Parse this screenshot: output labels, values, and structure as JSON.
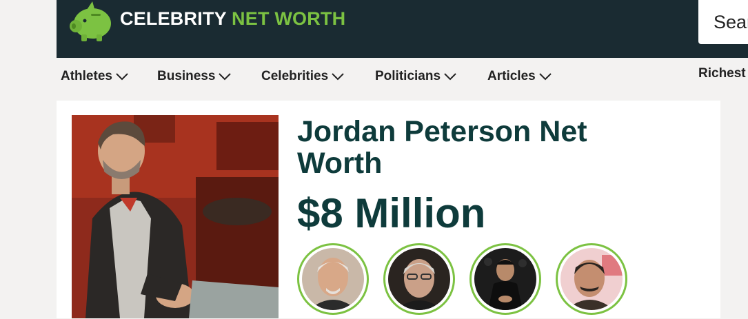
{
  "brand": {
    "name_part1": "CELEBRITY",
    "name_part2": "NET WORTH",
    "accent_color": "#7cc242",
    "header_color": "#1a2b32",
    "logo_icon": "piggy-bank-icon"
  },
  "search": {
    "placeholder": "Search"
  },
  "nav": {
    "items": [
      {
        "label": "Athletes",
        "icon": "chevron-down-icon"
      },
      {
        "label": "Business",
        "icon": "chevron-down-icon"
      },
      {
        "label": "Celebrities",
        "icon": "chevron-down-icon"
      },
      {
        "label": "Politicians",
        "icon": "chevron-down-icon"
      },
      {
        "label": "Articles",
        "icon": "chevron-down-icon"
      }
    ],
    "right_link": "Richest"
  },
  "article": {
    "title": "Jordan Peterson Net Worth",
    "net_worth": "$8 Million",
    "title_color": "#0e3b3b"
  },
  "related": {
    "count": 4,
    "ring_color": "#7cc242"
  }
}
